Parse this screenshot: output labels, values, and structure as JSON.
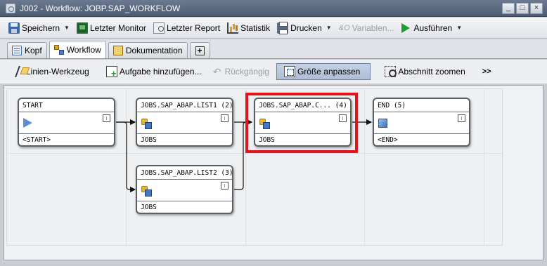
{
  "window": {
    "title": "J002 - Workflow: JOBP.SAP_WORKFLOW",
    "buttons": {
      "minimize": "_",
      "maximize": "□",
      "close": "×"
    }
  },
  "toolbar": {
    "save": "Speichern",
    "last_monitor": "Letzter Monitor",
    "last_report": "Letzter Report",
    "statistics": "Statistik",
    "print": "Drucken",
    "variables": "Variablen...",
    "variables_icon_glyph": "&O",
    "execute": "Ausführen"
  },
  "tabs": [
    {
      "label": "Kopf",
      "active": false
    },
    {
      "label": "Workflow",
      "active": true
    },
    {
      "label": "Dokumentation",
      "active": false
    },
    {
      "label": "+",
      "active": false
    }
  ],
  "workflow_toolbar": {
    "line_tool": "Linien-Werkzeug",
    "add_task": "Aufgabe hinzufügen...",
    "undo": "Rückgängig",
    "fit_size": "Größe anpassen",
    "zoom_section": "Abschnitt zoomen",
    "more": ">>"
  },
  "nodes": [
    {
      "id": "start",
      "title": "START",
      "footer": "<START>",
      "icon": "play-triangle-icon"
    },
    {
      "id": "list1",
      "title": "JOBS.SAP_ABAP.LIST1 (2)",
      "footer": "JOBS",
      "icon": "job-icon"
    },
    {
      "id": "list2",
      "title": "JOBS.SAP_ABAP.LIST2 (3)",
      "footer": "JOBS",
      "icon": "job-icon"
    },
    {
      "id": "c4",
      "title": "JOBS.SAP_ABAP.C... (4)",
      "footer": "JOBS",
      "icon": "job-icon",
      "highlighted": true
    },
    {
      "id": "end",
      "title": "END (5)",
      "footer": "<END>",
      "icon": "end-square-icon"
    }
  ],
  "edges": [
    [
      "start",
      "list1"
    ],
    [
      "start",
      "list2"
    ],
    [
      "list1",
      "c4"
    ],
    [
      "list2",
      "c4"
    ],
    [
      "c4",
      "end"
    ]
  ],
  "colors": {
    "highlight": "#e4141d",
    "titlebar": "#5b6a80",
    "execute": "#1f9d2f"
  }
}
